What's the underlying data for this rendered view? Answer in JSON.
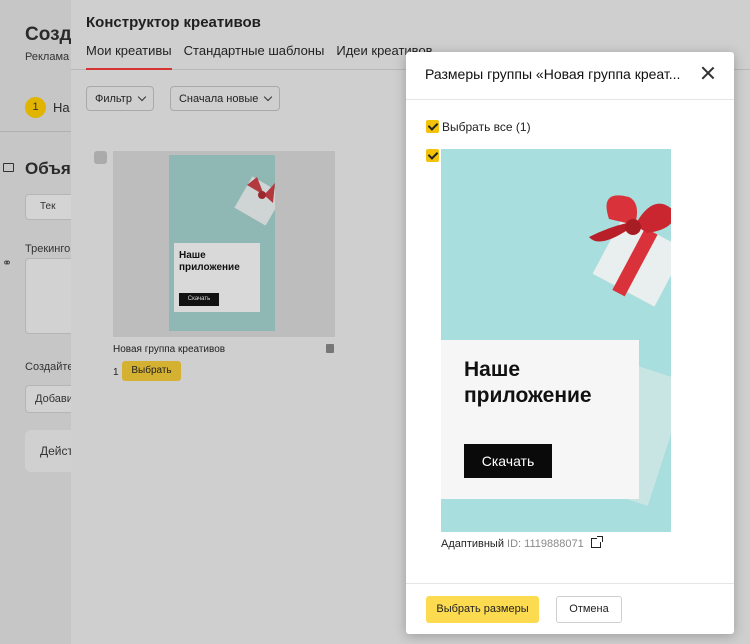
{
  "background_page": {
    "title": "Созда",
    "subtitle": "Реклама",
    "step_number": "1",
    "step_label": "На",
    "section_title": "Объя",
    "button_label": "Тек",
    "tracking_label": "Трекинго",
    "create_label": "Создайте",
    "add_label": "Добави",
    "action_label": "Дейст"
  },
  "constructor": {
    "title": "Конструктор креативов",
    "tabs": [
      {
        "label": "Мои креативы",
        "active": true
      },
      {
        "label": "Стандартные шаблоны",
        "active": false
      },
      {
        "label": "Идеи креативов",
        "active": false
      }
    ],
    "filter_label": "Фильтр",
    "sort_label": "Сначала новые",
    "card": {
      "thumb_title": "Наше приложение",
      "thumb_button": "Скачать",
      "name": "Новая группа креативов",
      "count": "1",
      "select_label": "Выбрать"
    }
  },
  "dialog": {
    "title": "Размеры группы «Новая группа креат...",
    "select_all_label": "Выбрать все (1)",
    "creative": {
      "headline_line1": "Наше",
      "headline_line2": "приложение",
      "cta": "Скачать",
      "type_label": "Адаптивный",
      "id_text": "ID: 1119888071"
    },
    "primary_button": "Выбрать размеры",
    "cancel_button": "Отмена"
  },
  "colors": {
    "accent_yellow": "#fcdb50",
    "tab_underline": "#d63333",
    "creative_bg": "#a8dedd",
    "ribbon_red": "#d9323a"
  }
}
